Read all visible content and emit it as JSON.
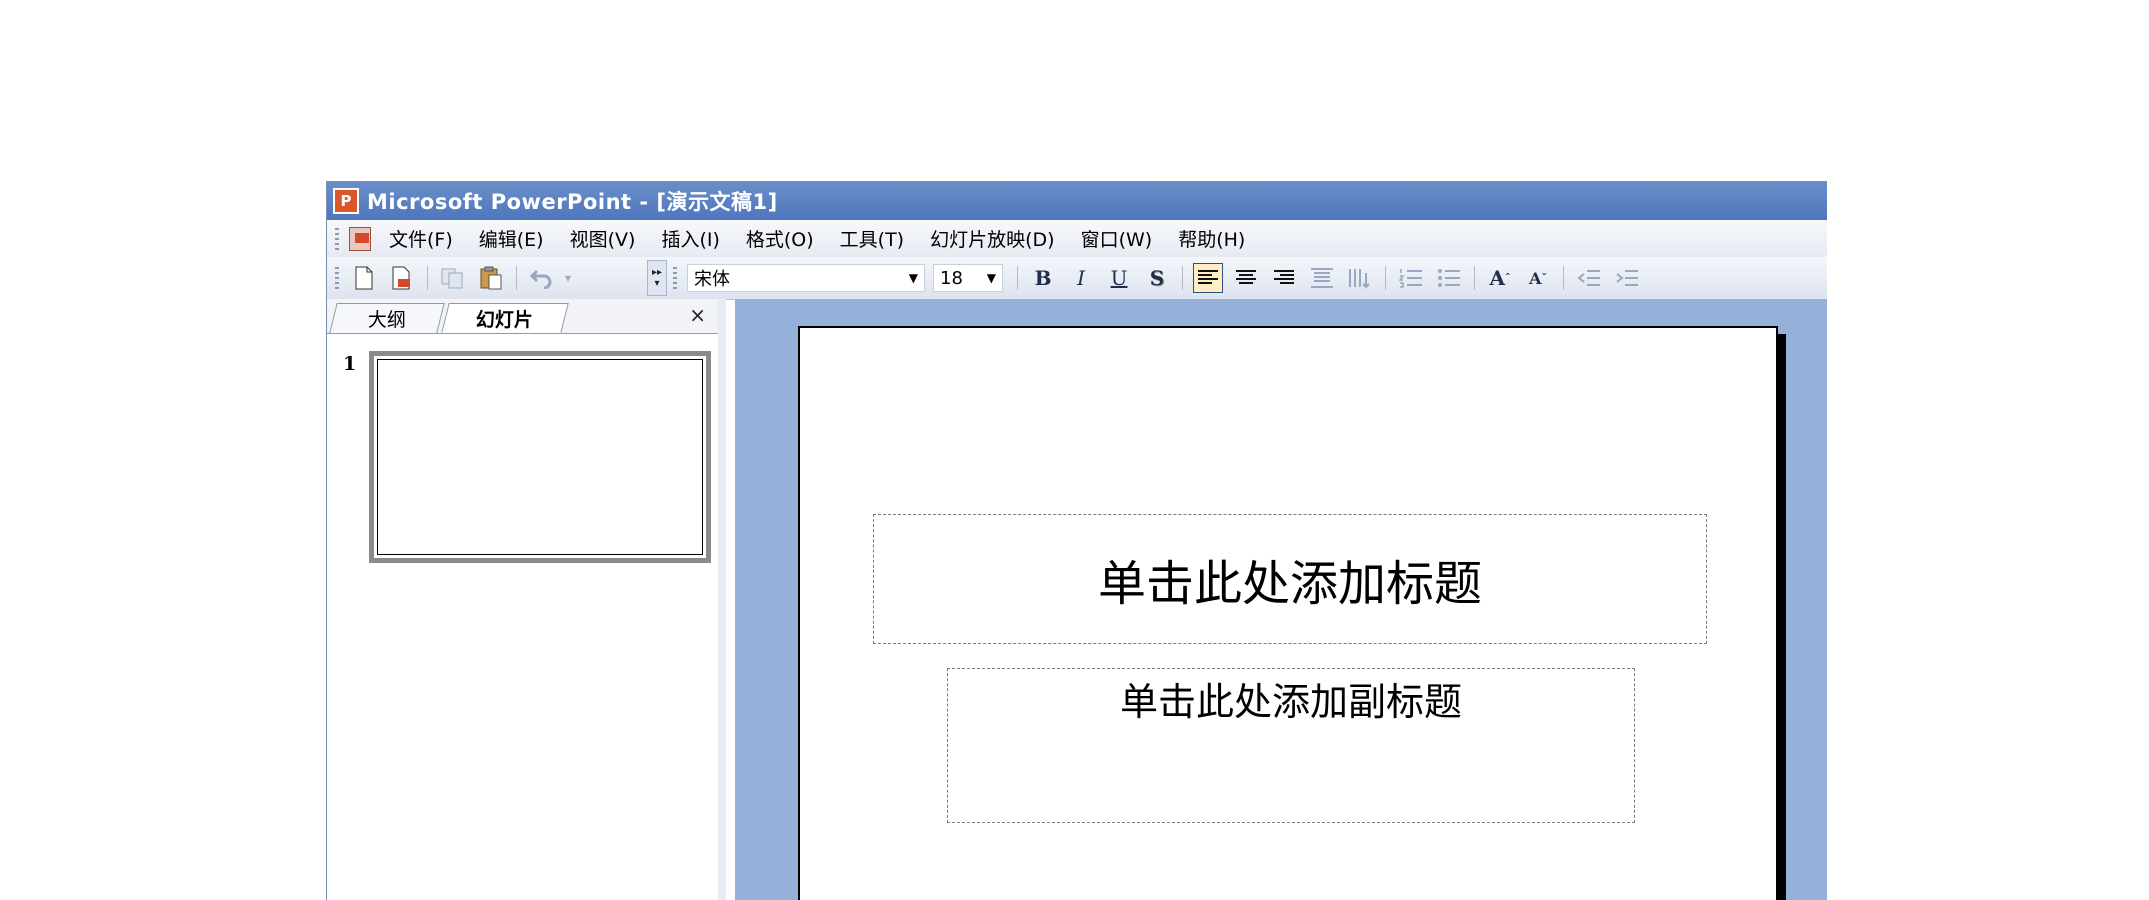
{
  "window": {
    "title": "Microsoft PowerPoint - [演示文稿1]",
    "icon": "powerpoint-app-icon"
  },
  "menu": {
    "items": [
      {
        "label": "文件(F)"
      },
      {
        "label": "编辑(E)"
      },
      {
        "label": "视图(V)"
      },
      {
        "label": "插入(I)"
      },
      {
        "label": "格式(O)"
      },
      {
        "label": "工具(T)"
      },
      {
        "label": "幻灯片放映(D)"
      },
      {
        "label": "窗口(W)"
      },
      {
        "label": "帮助(H)"
      }
    ]
  },
  "toolbar": {
    "font_name": "宋体",
    "font_size": "18",
    "bold": "B",
    "italic": "I",
    "underline": "U",
    "shadow": "S",
    "grow_font": "A",
    "shrink_font": "A"
  },
  "pane": {
    "tabs": [
      {
        "label": "大纲"
      },
      {
        "label": "幻灯片"
      }
    ],
    "active_tab": "幻灯片",
    "close": "×",
    "slide_number": "1"
  },
  "slide": {
    "title_placeholder": "单击此处添加标题",
    "subtitle_placeholder": "单击此处添加副标题"
  },
  "colors": {
    "titlebar": "#4e76bd",
    "workspace": "#96b1d9",
    "active_button": "#ffeec2"
  }
}
